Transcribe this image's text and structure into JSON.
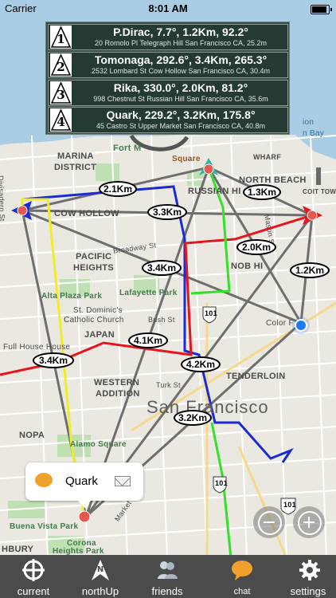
{
  "status_bar": {
    "carrier": "Carrier",
    "time": "8:01 AM"
  },
  "friends_panel": {
    "rows": [
      {
        "rank": "1",
        "title": "P.Dirac, 7.7°, 1.2Km,  92.2°",
        "address": "20 Romolo Pl Telegraph Hill San Francisco  CA,  25.2m"
      },
      {
        "rank": "2",
        "title": "Tomonaga, 292.6°, 3.4Km,  265.3°",
        "address": "2532 Lombard St Cow Hollow San Francisco  CA,  30.4m"
      },
      {
        "rank": "3",
        "title": "Rika, 330.0°, 2.0Km,  81.2°",
        "address": "998 Chestnut St Russian Hill San Francisco  CA,  35.6m"
      },
      {
        "rank": "4",
        "title": "Quark, 229.2°, 3.2Km,  175.8°",
        "address": "45 Castro St Upper Market San Francisco  CA,  40.8m"
      }
    ]
  },
  "map": {
    "labels": {
      "marina": "MARINA",
      "district": "DISTRICT",
      "cow_hollow": "COW HOLLOW",
      "pacific": "PACIFIC",
      "heights": "HEIGHTS",
      "north_beach": "NORTH BEACH",
      "russian_hill": "RUSSIAN HI",
      "nob_hill": "NOB HI",
      "tenderloin": "TENDERLOIN",
      "western": "WESTERN",
      "addition": "ADDITION",
      "nopa": "NOPA",
      "japantown": "JAPAN",
      "san_francisco": "San Francisco",
      "alta_plaza": "Alta Plaza Park",
      "lafayette": "Lafayette Park",
      "st_dominic_1": "St. Dominic's",
      "st_dominic_2": "Catholic Church",
      "full_house": "Full House House",
      "alamo": "Alamo Square",
      "buena_vista": "Buena Vista Park",
      "corona_1": "Corona",
      "corona_2": "Heights Park",
      "coit": "COIT TOWER",
      "fort_mason": "Fort M",
      "square": "Square",
      "wharf": "WHARF",
      "color_factory": "Color F",
      "divisadero": "Divisadero St",
      "broadway": "Broadway St",
      "bush": "Bush St",
      "turk": "Turk St",
      "mason": "Mason St",
      "market": "Market St",
      "hwy_101": "101",
      "ashbury": "HBURY",
      "bay": "n Bay",
      "ion": "ion"
    },
    "distances": [
      "2.1Km",
      "1.3Km",
      "3.3Km",
      "2.0Km",
      "3.4Km",
      "1.2Km",
      "4.1Km",
      "4.2Km",
      "3.4Km",
      "3.2Km"
    ],
    "colors": {
      "red_route": "#e8141b",
      "blue_route": "#1a2bd6",
      "green_route": "#33e02a",
      "yellow_route": "#f2ec28",
      "gray_lines": "#6e6e6e",
      "user_location": "#1e7af2"
    }
  },
  "callout": {
    "name": "Quark"
  },
  "tabs": [
    {
      "label": "current",
      "icon": "crosshair-icon"
    },
    {
      "label": "northUp",
      "icon": "north-arrow-icon"
    },
    {
      "label": "friends",
      "icon": "friends-icon"
    },
    {
      "label": "chat",
      "icon": "chat-bubble-icon"
    },
    {
      "label": "settings",
      "icon": "gear-icon"
    }
  ]
}
